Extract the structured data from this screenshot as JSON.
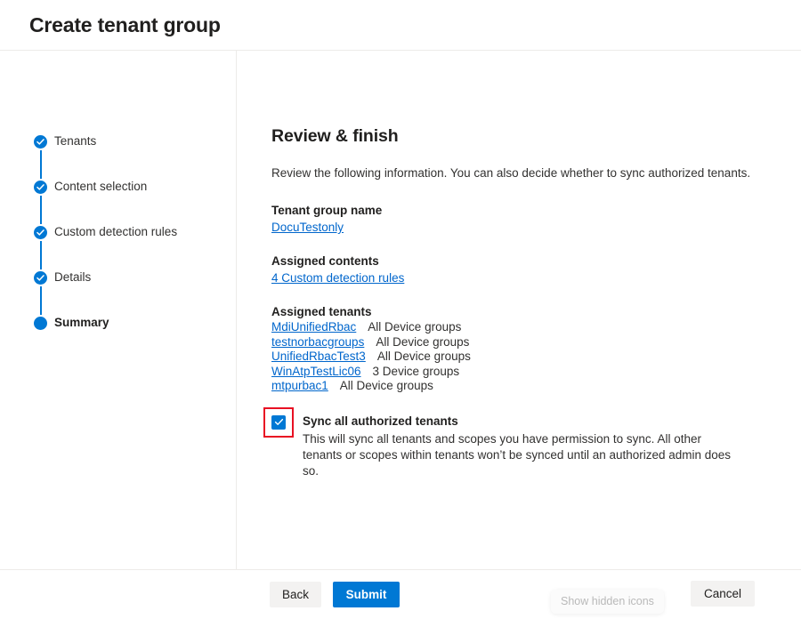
{
  "header": {
    "title": "Create tenant group"
  },
  "stepper": {
    "steps": [
      {
        "label": "Tenants",
        "state": "completed"
      },
      {
        "label": "Content selection",
        "state": "completed"
      },
      {
        "label": "Custom detection rules",
        "state": "completed"
      },
      {
        "label": "Details",
        "state": "completed"
      },
      {
        "label": "Summary",
        "state": "current"
      }
    ]
  },
  "content": {
    "title": "Review & finish",
    "intro": "Review the following information. You can also decide whether to sync authorized tenants.",
    "tenant_group_name": {
      "label": "Tenant group name",
      "value": "DocuTestonly"
    },
    "assigned_contents": {
      "label": "Assigned contents",
      "value": "4 Custom detection rules"
    },
    "assigned_tenants": {
      "label": "Assigned tenants",
      "rows": [
        {
          "name": "MdiUnifiedRbac",
          "scope": "All Device groups"
        },
        {
          "name": "testnorbacgroups",
          "scope": "All Device groups"
        },
        {
          "name": "UnifiedRbacTest3",
          "scope": "All Device groups"
        },
        {
          "name": "WinAtpTestLic06",
          "scope": "3 Device groups"
        },
        {
          "name": "mtpurbac1",
          "scope": "All Device groups"
        }
      ]
    },
    "sync_option": {
      "title": "Sync all authorized tenants",
      "description": "This will sync all tenants and scopes you have permission to sync. All other tenants or scopes within tenants won’t be synced until an authorized admin does so.",
      "checked": true
    }
  },
  "footer": {
    "back_label": "Back",
    "submit_label": "Submit",
    "cancel_label": "Cancel"
  },
  "overlay": {
    "tooltip_label": "Show hidden icons"
  },
  "colors": {
    "accent": "#0078d4",
    "link": "#0066cc",
    "annotation": "#e81123",
    "divider": "#edebe9",
    "button_secondary": "#f3f2f1"
  }
}
